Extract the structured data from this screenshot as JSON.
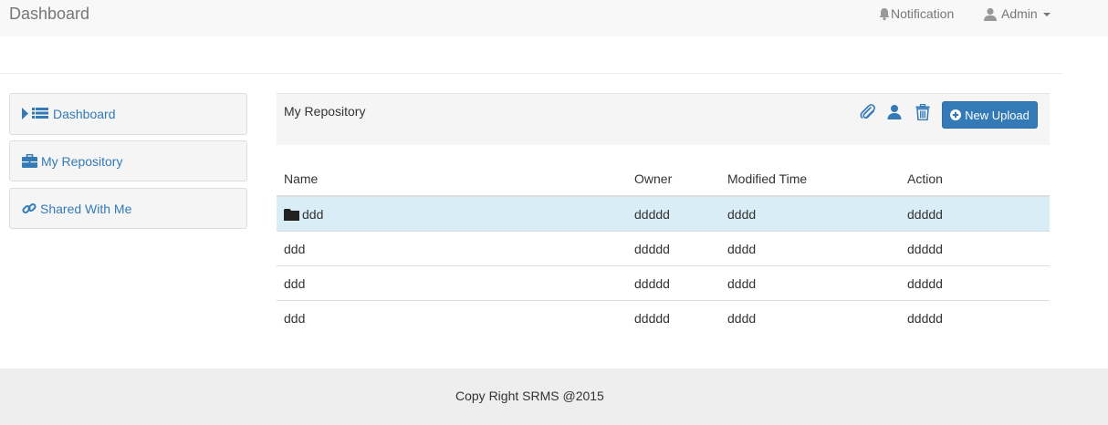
{
  "navbar": {
    "brand": "Dashboard",
    "notification_label": "Notification",
    "user_label": "Admin"
  },
  "sidebar": {
    "items": [
      {
        "label": "Dashboard",
        "icon": "list-icon"
      },
      {
        "label": "My Repository",
        "icon": "briefcase-icon"
      },
      {
        "label": "Shared With Me",
        "icon": "link-icon"
      }
    ]
  },
  "repository": {
    "title": "My Repository",
    "upload_label": "New Upload",
    "tools": [
      "paperclip-icon",
      "user-icon",
      "trash-icon"
    ]
  },
  "table": {
    "headers": [
      "Name",
      "Owner",
      "Modified Time",
      "Action"
    ],
    "rows": [
      {
        "name": "ddd",
        "owner": "ddddd",
        "modified": "dddd",
        "action": "ddddd",
        "folder": true,
        "selected": true
      },
      {
        "name": "ddd",
        "owner": "ddddd",
        "modified": "dddd",
        "action": "ddddd"
      },
      {
        "name": "ddd",
        "owner": "ddddd",
        "modified": "dddd",
        "action": "ddddd"
      },
      {
        "name": "ddd",
        "owner": "ddddd",
        "modified": "dddd",
        "action": "ddddd"
      }
    ]
  },
  "footer": {
    "text": "Copy Right SRMS @2015"
  },
  "colors": {
    "primary": "#337ab7",
    "selected_row": "#d9edf7",
    "navbar": "#f8f8f8",
    "footer": "#eeeeee"
  }
}
